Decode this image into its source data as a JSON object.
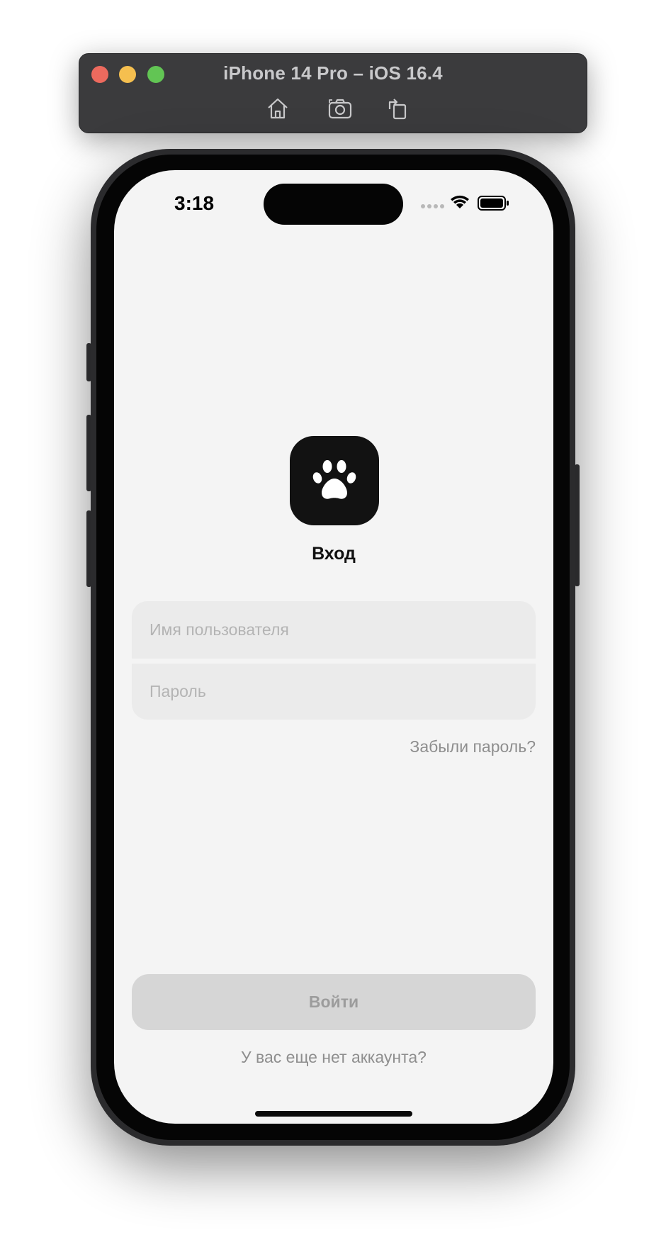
{
  "simulator": {
    "title": "iPhone 14 Pro – iOS 16.4",
    "tools": [
      "home-icon",
      "screenshot-icon",
      "rotate-icon"
    ]
  },
  "status_bar": {
    "time": "3:18",
    "icons": [
      "cellular-icon",
      "wifi-icon",
      "battery-icon"
    ]
  },
  "login": {
    "app_icon": "paw-icon",
    "title": "Вход",
    "username_placeholder": "Имя пользователя",
    "username_value": "",
    "password_placeholder": "Пароль",
    "password_value": "",
    "forgot_link": "Забыли пароль?",
    "login_button": "Войти",
    "signup_link": "У вас еще нет аккаунта?"
  },
  "colors": {
    "screen_bg": "#f4f4f4",
    "field_bg": "#ebebeb",
    "button_disabled_bg": "#d6d6d6",
    "link_gray": "#8e8e8e",
    "icon_bg": "#121212"
  }
}
